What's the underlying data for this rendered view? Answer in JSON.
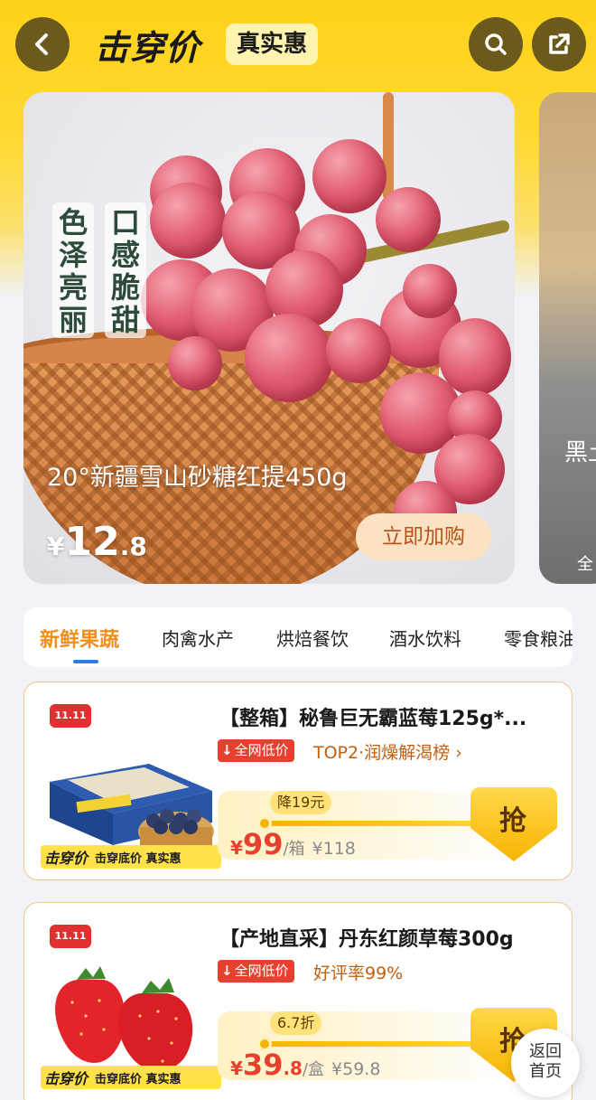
{
  "header": {
    "logo_text": "击穿价",
    "tag": "真实惠",
    "back_icon": "chevron-left-icon",
    "search_icon": "search-icon",
    "share_icon": "share-icon"
  },
  "hero": {
    "label_left": "色泽亮丽",
    "label_right": "口感脆甜",
    "title": "20°新疆雪山砂糖红提450g",
    "price_symbol": "¥",
    "price_int": "12",
    "price_dec": ".8",
    "buy_label": "立即加购"
  },
  "side_card": {
    "title": "黑土",
    "sub": "全"
  },
  "tabs": [
    {
      "label": "新鲜果蔬",
      "active": true
    },
    {
      "label": "肉禽水产",
      "active": false
    },
    {
      "label": "烘焙餐饮",
      "active": false
    },
    {
      "label": "酒水饮料",
      "active": false
    },
    {
      "label": "零食粮油",
      "active": false
    }
  ],
  "products": [
    {
      "badge": "11.11",
      "title": "【整箱】秘鲁巨无霸蓝莓125g*...",
      "low_tag": "全网低价",
      "rank": "TOP2·润燥解渴榜",
      "rank_chevron": "›",
      "discount": "降19元",
      "price_symbol": "¥",
      "price_int": "99",
      "price_dec": "",
      "unit": "/箱",
      "original_price": "¥118",
      "grab_label": "抢",
      "strip_logo": "击穿价",
      "strip_text": "击穿底价 真实惠",
      "progress": 0.85
    },
    {
      "badge": "11.11",
      "title": "【产地直采】丹东红颜草莓300g",
      "low_tag": "全网低价",
      "rank": "好评率99%",
      "rank_chevron": "",
      "discount": "6.7折",
      "price_symbol": "¥",
      "price_int": "39",
      "price_dec": ".8",
      "unit": "/盒",
      "original_price": "¥59.8",
      "grab_label": "抢",
      "strip_logo": "击穿价",
      "strip_text": "击穿底价 真实惠",
      "progress": 0.85
    }
  ],
  "float_button": {
    "line1": "返回",
    "line2": "首页"
  }
}
